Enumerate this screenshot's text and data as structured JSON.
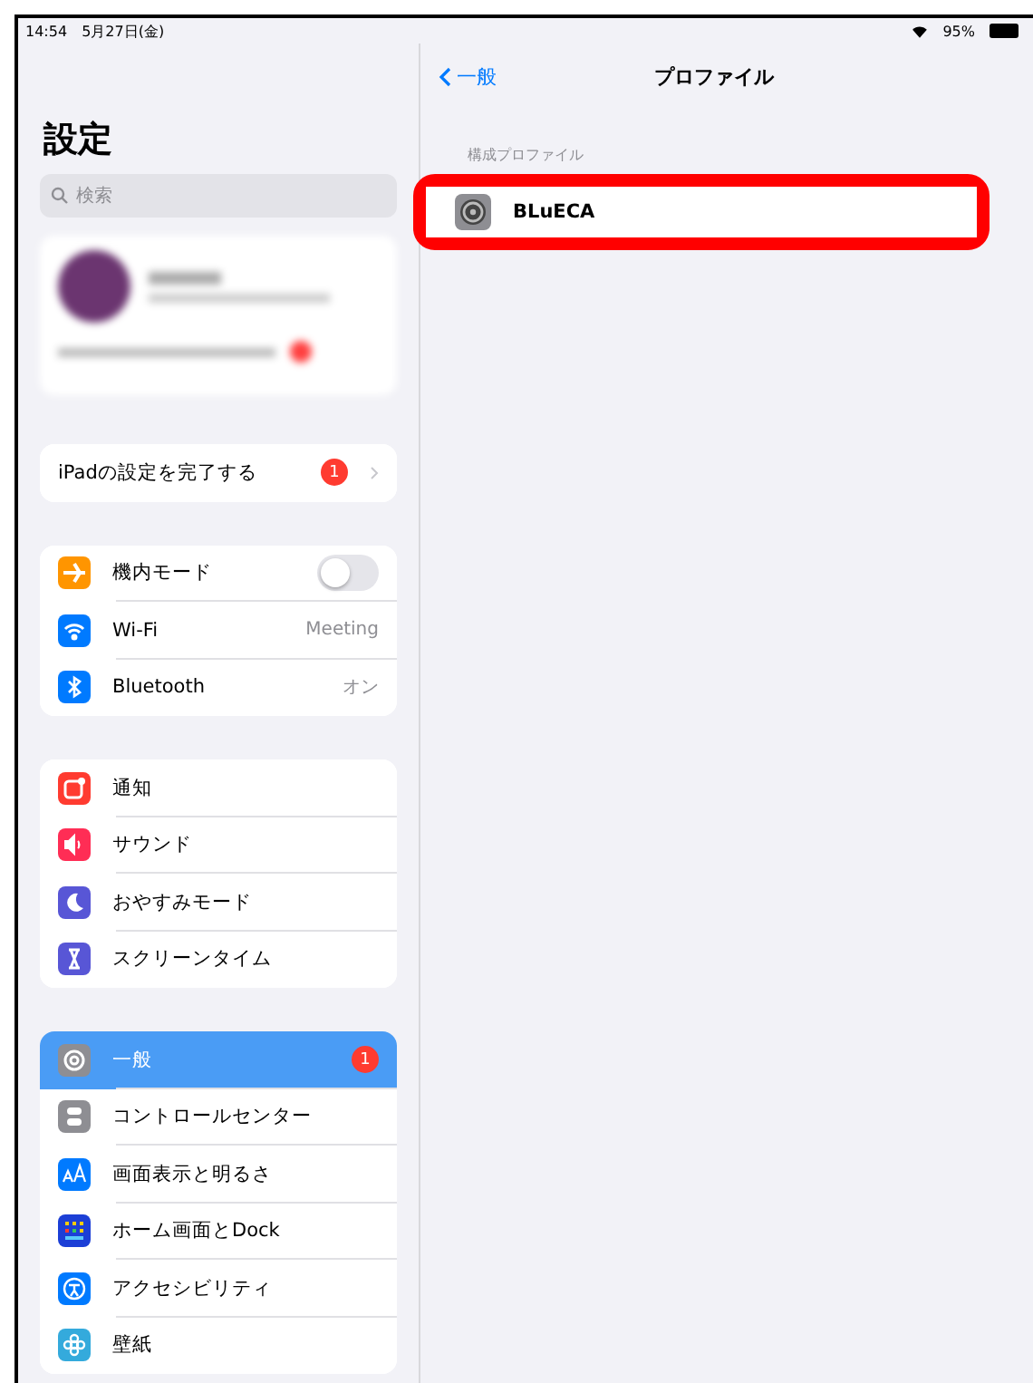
{
  "status_bar": {
    "time": "14:54",
    "date": "5月27日(金)",
    "battery": "95%"
  },
  "sidebar": {
    "title": "設定",
    "search": {
      "placeholder": "検索"
    },
    "setup_row": {
      "label": "iPadの設定を完了する",
      "badge": "1"
    },
    "groups": [
      [
        {
          "kind": "toggle",
          "label": "機内モード",
          "on": false,
          "selected": false
        },
        {
          "kind": "value",
          "label": "Wi-Fi",
          "value": "Meeting",
          "selected": false
        },
        {
          "kind": "value",
          "label": "Bluetooth",
          "value": "オン",
          "selected": false
        }
      ],
      [
        {
          "kind": "plain",
          "label": "通知",
          "selected": false
        },
        {
          "kind": "plain",
          "label": "サウンド",
          "selected": false
        },
        {
          "kind": "plain",
          "label": "おやすみモード",
          "selected": false
        },
        {
          "kind": "plain",
          "label": "スクリーンタイム",
          "selected": false
        }
      ],
      [
        {
          "kind": "plain",
          "label": "一般",
          "badge": "1",
          "selected": true
        },
        {
          "kind": "plain",
          "label": "コントロールセンター",
          "selected": false
        },
        {
          "kind": "plain",
          "label": "画面表示と明るさ",
          "selected": false
        },
        {
          "kind": "plain",
          "label": "ホーム画面とDock",
          "selected": false
        },
        {
          "kind": "plain",
          "label": "アクセシビリティ",
          "selected": false
        },
        {
          "kind": "plain",
          "label": "壁紙",
          "selected": false
        }
      ]
    ]
  },
  "detail": {
    "back": "一般",
    "title": "プロファイル",
    "section_header": "構成プロファイル",
    "profiles": [
      {
        "name": "BLuECA",
        "highlighted": true
      }
    ]
  }
}
